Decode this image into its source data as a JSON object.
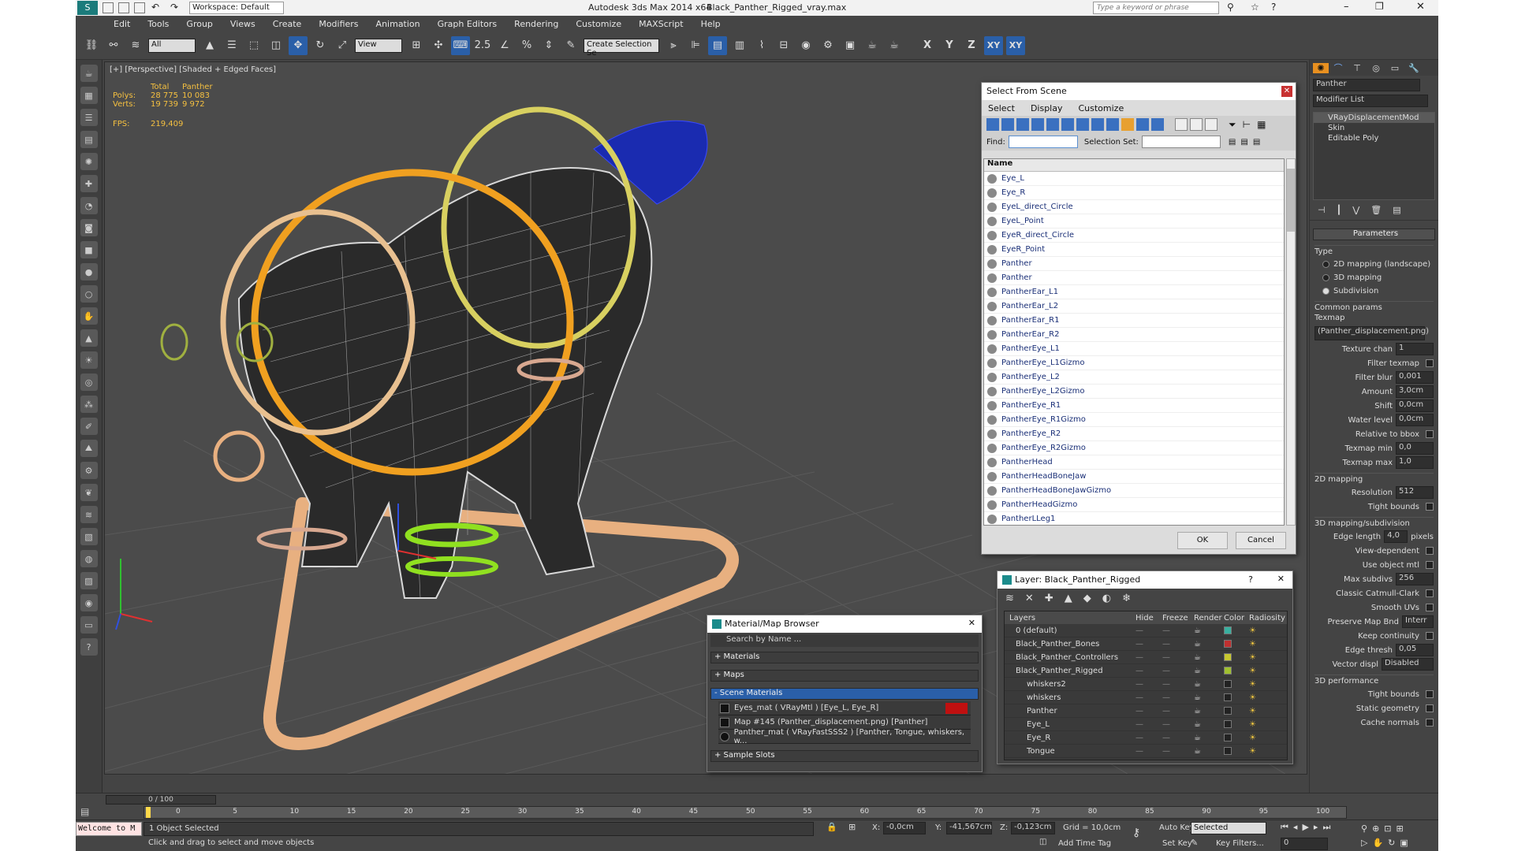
{
  "titlebar": {
    "app_title": "Autodesk 3ds Max  2014 x64",
    "file_name": "Black_Panther_Rigged_vray.max",
    "workspace": "Workspace: Default",
    "search_placeholder": "Type a keyword or phrase"
  },
  "menu": [
    "Edit",
    "Tools",
    "Group",
    "Views",
    "Create",
    "Modifiers",
    "Animation",
    "Graph Editors",
    "Rendering",
    "Customize",
    "MAXScript",
    "Help"
  ],
  "toolbar": {
    "selection_filter": "All",
    "ref_coord": "View",
    "snap_label": "2.5",
    "named_selection_placeholder": "Create Selection Se",
    "axes": [
      "X",
      "Y",
      "Z",
      "XY",
      "XY"
    ]
  },
  "viewport": {
    "label": "[+] [Perspective] [Shaded + Edged Faces]",
    "stats": {
      "col_total": "Total",
      "col_panther": "Panther",
      "polys_label": "Polys:",
      "polys_total": "28 775",
      "polys_panther": "10 083",
      "verts_label": "Verts:",
      "verts_total": "19 739",
      "verts_panther": "9 972",
      "fps_label": "FPS:",
      "fps_value": "219,409"
    }
  },
  "select_dialog": {
    "title": "Select From Scene",
    "menu": [
      "Select",
      "Display",
      "Customize"
    ],
    "find_label": "Find:",
    "selection_set_label": "Selection Set:",
    "column_name": "Name",
    "items": [
      "Eye_L",
      "Eye_R",
      "EyeL_direct_Circle",
      "EyeL_Point",
      "EyeR_direct_Circle",
      "EyeR_Point",
      "Panther",
      "Panther",
      "PantherEar_L1",
      "PantherEar_L2",
      "PantherEar_R1",
      "PantherEar_R2",
      "PantherEye_L1",
      "PantherEye_L1Gizmo",
      "PantherEye_L2",
      "PantherEye_L2Gizmo",
      "PantherEye_R1",
      "PantherEye_R1Gizmo",
      "PantherEye_R2",
      "PantherEye_R2Gizmo",
      "PantherHead",
      "PantherHeadBoneJaw",
      "PantherHeadBoneJawGizmo",
      "PantherHeadGizmo",
      "PantherLLeg1"
    ],
    "ok": "OK",
    "cancel": "Cancel"
  },
  "layer_dialog": {
    "title": "Layer: Black_Panther_Rigged",
    "help": "?",
    "columns": [
      "Layers",
      "Hide",
      "Freeze",
      "Render",
      "Color",
      "Radiosity"
    ],
    "rows": [
      {
        "name": "0 (default)",
        "color": "#39b0a0",
        "indent": 0
      },
      {
        "name": "Black_Panther_Bones",
        "color": "#c03030",
        "indent": 0
      },
      {
        "name": "Black_Panther_Controllers",
        "color": "#c8c830",
        "indent": 0
      },
      {
        "name": "Black_Panther_Rigged",
        "color": "#a0c030",
        "indent": 0
      },
      {
        "name": "whiskers2",
        "color": "#222222",
        "indent": 1
      },
      {
        "name": "whiskers",
        "color": "#222222",
        "indent": 1
      },
      {
        "name": "Panther",
        "color": "#222222",
        "indent": 1
      },
      {
        "name": "Eye_L",
        "color": "#222222",
        "indent": 1
      },
      {
        "name": "Eye_R",
        "color": "#222222",
        "indent": 1
      },
      {
        "name": "Tongue",
        "color": "#222222",
        "indent": 1
      }
    ]
  },
  "material_browser": {
    "title": "Material/Map Browser",
    "search_placeholder": "Search by Name ...",
    "sections": [
      "+ Materials",
      "+ Maps",
      "- Scene Materials"
    ],
    "items": [
      "Eyes_mat  ( VRayMtl ) [Eye_L, Eye_R]",
      "Map #145 (Panther_displacement.png) [Panther]",
      "Panther_mat  ( VRayFastSSS2 ) [Panther, Tongue, whiskers, w..."
    ],
    "sample_slots": "+ Sample Slots"
  },
  "command_panel": {
    "object_name": "Panther",
    "modifier_list": "Modifier List",
    "stack": [
      "VRayDisplacementMod",
      "Skin",
      "Editable Poly"
    ],
    "parameters_title": "Parameters",
    "type_label": "Type",
    "type_options": [
      "2D mapping (landscape)",
      "3D mapping",
      "Subdivision"
    ],
    "common_params": "Common params",
    "texmap_label": "Texmap",
    "texmap_value": "(Panther_displacement.png)",
    "texture_chan_label": "Texture chan",
    "texture_chan_value": "1",
    "filter_texmap": "Filter texmap",
    "filter_blur_label": "Filter blur",
    "filter_blur_value": "0,001",
    "amount_label": "Amount",
    "amount_value": "3,0cm",
    "shift_label": "Shift",
    "shift_value": "0,0cm",
    "water_level_label": "Water level",
    "water_level_value": "0,0cm",
    "relative_bbox": "Relative to bbox",
    "texmap_min_label": "Texmap min",
    "texmap_min_value": "0,0",
    "texmap_max_label": "Texmap max",
    "texmap_max_value": "1,0",
    "mapping2d": "2D mapping",
    "resolution_label": "Resolution",
    "resolution_value": "512",
    "tight_bounds": "Tight bounds",
    "mapping3d": "3D mapping/subdivision",
    "edge_length_label": "Edge length",
    "edge_length_value": "4,0",
    "pixels": "pixels",
    "view_dependent": "View-dependent",
    "use_object_mtl": "Use object mtl",
    "max_subdivs_label": "Max subdivs",
    "max_subdivs_value": "256",
    "classic_catmull": "Classic Catmull-Clark",
    "smooth_uvs": "Smooth UVs",
    "preserve_map": "Preserve Map Bnd",
    "preserve_value": "Interr",
    "keep_continuity": "Keep continuity",
    "edge_thresh_label": "Edge thresh",
    "edge_thresh_value": "0,05",
    "vector_disp_label": "Vector displ",
    "vector_disp_value": "Disabled",
    "perf_title": "3D performance",
    "tight_bounds2": "Tight bounds",
    "static_geometry": "Static geometry",
    "cache_normals": "Cache normals"
  },
  "timeline": {
    "frame": "0 / 100",
    "ticks": [
      "0",
      "5",
      "10",
      "15",
      "20",
      "25",
      "30",
      "35",
      "40",
      "45",
      "50",
      "55",
      "60",
      "65",
      "70",
      "75",
      "80",
      "85",
      "90",
      "95",
      "100"
    ]
  },
  "status": {
    "maxscript": "Welcome to M",
    "selected": "1 Object Selected",
    "prompt": "Click and drag to select and move objects",
    "x_label": "X:",
    "x_value": "-0,0cm",
    "y_label": "Y:",
    "y_value": "-41,567cm",
    "z_label": "Z:",
    "z_value": "-0,123cm",
    "grid": "Grid = 10,0cm",
    "add_time_tag": "Add Time Tag",
    "auto_key": "Auto Key",
    "auto_key_value": "Selected",
    "set_key": "Set Key",
    "key_filters": "Key Filters...",
    "frame_value": "0"
  }
}
